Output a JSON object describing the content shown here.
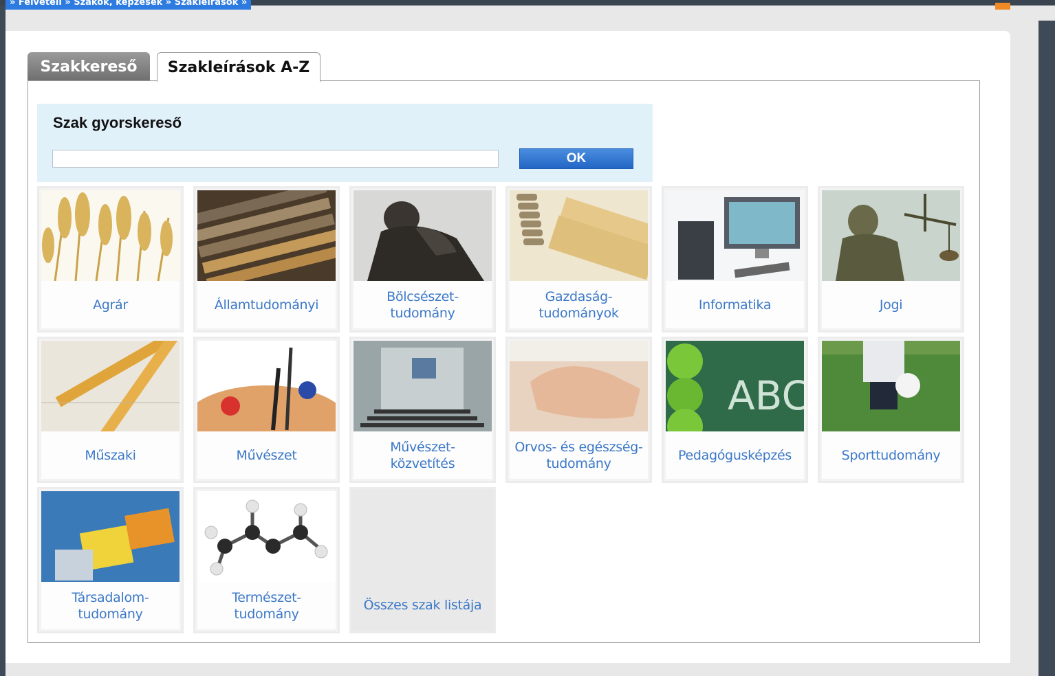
{
  "breadcrumb": "» Felvételi » Szakok, képzések » Szakleírások »",
  "tabs": {
    "search": "Szakkereső",
    "az": "Szakleírások A-Z"
  },
  "quick_search": {
    "title": "Szak gyorskereső",
    "value": "",
    "ok_label": "OK"
  },
  "tiles": [
    {
      "label": "Agrár"
    },
    {
      "label": "Államtudományi"
    },
    {
      "label": "Bölcsészet-\ntudomány"
    },
    {
      "label": "Gazdaság-\ntudományok"
    },
    {
      "label": "Informatika"
    },
    {
      "label": "Jogi"
    },
    {
      "label": "Műszaki"
    },
    {
      "label": "Művészet"
    },
    {
      "label": "Művészet-\nközvetítés"
    },
    {
      "label": "Orvos- és egészség-\ntudomány"
    },
    {
      "label": "Pedagógusképzés"
    },
    {
      "label": "Sporttudomány"
    },
    {
      "label": "Társadalom-\ntudomány"
    },
    {
      "label": "Természet-\ntudomány"
    },
    {
      "label": "Összes szak listája"
    }
  ],
  "pictures": {
    "abc_text": "ABC"
  },
  "colors": {
    "link": "#3b78c8",
    "ok_button": "#2f72cf",
    "quick_bg": "#e1f1f9"
  }
}
